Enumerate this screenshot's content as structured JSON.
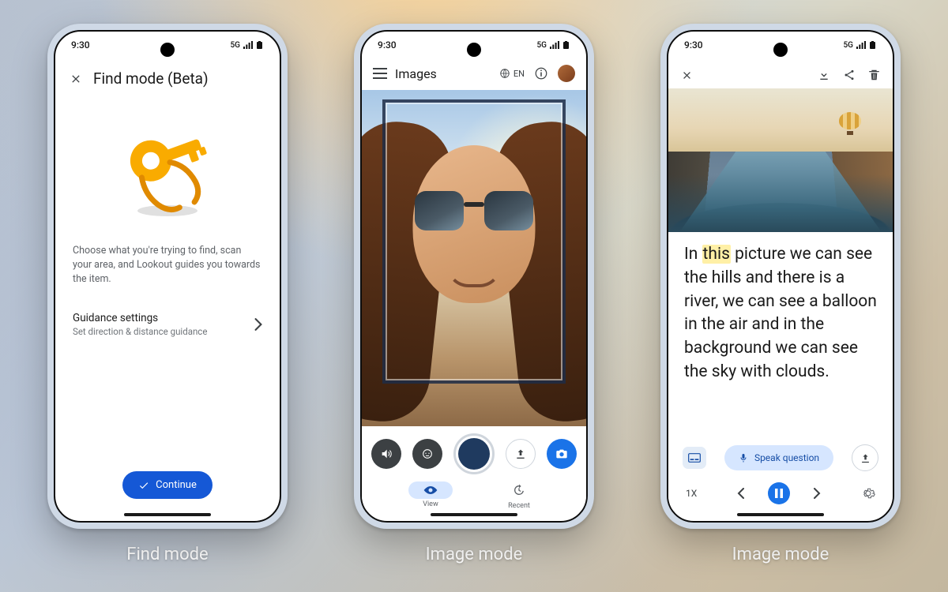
{
  "status": {
    "time": "9:30",
    "network": "5G"
  },
  "phone1": {
    "title": "Find mode (Beta)",
    "description": "Choose what you're trying to find, scan your area, and Lookout guides you towards the item.",
    "settings_label": "Guidance settings",
    "settings_sub": "Set direction & distance guidance",
    "cta": "Continue",
    "caption": "Find mode"
  },
  "phone2": {
    "header": "Images",
    "lang": "EN",
    "tabs": {
      "view": "View",
      "recent": "Recent"
    },
    "caption": "Image mode"
  },
  "phone3": {
    "desc_pre": "In ",
    "desc_hl": "this",
    "desc_post": " picture we can see the hills and there is a river, we can see a balloon in the air and in the background we can see the sky with clouds.",
    "speak": "Speak question",
    "speed": "1X",
    "caption": "Image mode"
  }
}
